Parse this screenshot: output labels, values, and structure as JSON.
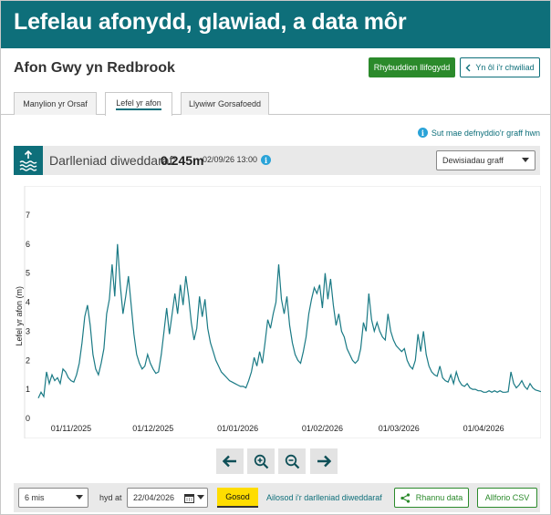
{
  "header": {
    "title": "Lefelau afonydd, glawiad, a data môr"
  },
  "station": {
    "name": "Afon Gwy yn Redbrook"
  },
  "actions": {
    "flood_warnings": "Rhybuddion llifogydd",
    "back_to_search": "Yn ôl i'r chwiliad"
  },
  "tabs": [
    {
      "label": "Manylion yr Orsaf",
      "active": false
    },
    {
      "label": "Lefel yr afon",
      "active": true
    },
    {
      "label": "Llywiwr Gorsafoedd",
      "active": false
    }
  ],
  "help_link": "Sut mae defnyddio'r graff hwn",
  "latest": {
    "label": "Darlleniad diweddaraf:",
    "value": "0.245m",
    "timestamp": "02/09/26 13:00"
  },
  "graph_settings": {
    "label": "Dewisiadau graff"
  },
  "chart_data": {
    "type": "line",
    "ylabel": "Lefel yr afon (m)",
    "ylim": [
      0,
      7.5
    ],
    "yticks": [
      0,
      1,
      2,
      3,
      4,
      5,
      6,
      7
    ],
    "xlim": [
      "2025-10-20",
      "2026-04-22"
    ],
    "xticks": [
      {
        "date": "2025-11-01",
        "label": "01/11/2025"
      },
      {
        "date": "2025-12-01",
        "label": "01/12/2025"
      },
      {
        "date": "2026-01-01",
        "label": "01/01/2026"
      },
      {
        "date": "2026-02-01",
        "label": "01/02/2026"
      },
      {
        "date": "2026-03-01",
        "label": "01/03/2026"
      },
      {
        "date": "2026-04-01",
        "label": "01/04/2026"
      }
    ],
    "line_color": "#1a7a85",
    "series": [
      {
        "values": [
          [
            "2025-10-20",
            0.7
          ],
          [
            "2025-10-21",
            0.9
          ],
          [
            "2025-10-22",
            0.75
          ],
          [
            "2025-10-23",
            1.6
          ],
          [
            "2025-10-24",
            1.2
          ],
          [
            "2025-10-25",
            1.5
          ],
          [
            "2025-10-26",
            1.3
          ],
          [
            "2025-10-27",
            1.4
          ],
          [
            "2025-10-28",
            1.2
          ],
          [
            "2025-10-29",
            1.7
          ],
          [
            "2025-10-30",
            1.6
          ],
          [
            "2025-10-31",
            1.4
          ],
          [
            "2025-11-01",
            1.3
          ],
          [
            "2025-11-02",
            1.25
          ],
          [
            "2025-11-03",
            1.5
          ],
          [
            "2025-11-04",
            1.9
          ],
          [
            "2025-11-05",
            2.6
          ],
          [
            "2025-11-06",
            3.5
          ],
          [
            "2025-11-07",
            3.9
          ],
          [
            "2025-11-08",
            3.2
          ],
          [
            "2025-11-09",
            2.2
          ],
          [
            "2025-11-10",
            1.7
          ],
          [
            "2025-11-11",
            1.5
          ],
          [
            "2025-11-12",
            1.9
          ],
          [
            "2025-11-13",
            2.4
          ],
          [
            "2025-11-14",
            3.6
          ],
          [
            "2025-11-15",
            4.1
          ],
          [
            "2025-11-16",
            5.3
          ],
          [
            "2025-11-17",
            4.2
          ],
          [
            "2025-11-18",
            6.0
          ],
          [
            "2025-11-19",
            4.6
          ],
          [
            "2025-11-20",
            3.6
          ],
          [
            "2025-11-21",
            4.2
          ],
          [
            "2025-11-22",
            4.9
          ],
          [
            "2025-11-23",
            3.9
          ],
          [
            "2025-11-24",
            2.9
          ],
          [
            "2025-11-25",
            2.2
          ],
          [
            "2025-11-26",
            1.9
          ],
          [
            "2025-11-27",
            1.7
          ],
          [
            "2025-11-28",
            1.8
          ],
          [
            "2025-11-29",
            2.2
          ],
          [
            "2025-11-30",
            1.9
          ],
          [
            "2025-12-01",
            1.7
          ],
          [
            "2025-12-02",
            1.55
          ],
          [
            "2025-12-03",
            1.6
          ],
          [
            "2025-12-04",
            2.2
          ],
          [
            "2025-12-05",
            3.0
          ],
          [
            "2025-12-06",
            3.8
          ],
          [
            "2025-12-07",
            2.9
          ],
          [
            "2025-12-08",
            3.6
          ],
          [
            "2025-12-09",
            4.3
          ],
          [
            "2025-12-10",
            3.6
          ],
          [
            "2025-12-11",
            4.6
          ],
          [
            "2025-12-12",
            3.9
          ],
          [
            "2025-12-13",
            4.9
          ],
          [
            "2025-12-14",
            4.2
          ],
          [
            "2025-12-15",
            3.3
          ],
          [
            "2025-12-16",
            2.7
          ],
          [
            "2025-12-17",
            3.1
          ],
          [
            "2025-12-18",
            4.2
          ],
          [
            "2025-12-19",
            3.5
          ],
          [
            "2025-12-20",
            4.1
          ],
          [
            "2025-12-21",
            3.1
          ],
          [
            "2025-12-22",
            2.6
          ],
          [
            "2025-12-23",
            2.3
          ],
          [
            "2025-12-24",
            2.0
          ],
          [
            "2025-12-25",
            1.8
          ],
          [
            "2025-12-26",
            1.6
          ],
          [
            "2025-12-27",
            1.5
          ],
          [
            "2025-12-28",
            1.4
          ],
          [
            "2025-12-29",
            1.3
          ],
          [
            "2025-12-30",
            1.25
          ],
          [
            "2025-12-31",
            1.2
          ],
          [
            "2026-01-01",
            1.15
          ],
          [
            "2026-01-02",
            1.1
          ],
          [
            "2026-01-03",
            1.1
          ],
          [
            "2026-01-04",
            1.05
          ],
          [
            "2026-01-05",
            1.3
          ],
          [
            "2026-01-06",
            1.6
          ],
          [
            "2026-01-07",
            2.1
          ],
          [
            "2026-01-08",
            1.8
          ],
          [
            "2026-01-09",
            2.3
          ],
          [
            "2026-01-10",
            1.9
          ],
          [
            "2026-01-11",
            2.6
          ],
          [
            "2026-01-12",
            3.4
          ],
          [
            "2026-01-13",
            3.1
          ],
          [
            "2026-01-14",
            3.6
          ],
          [
            "2026-01-15",
            4.0
          ],
          [
            "2026-01-16",
            5.3
          ],
          [
            "2026-01-17",
            4.1
          ],
          [
            "2026-01-18",
            3.6
          ],
          [
            "2026-01-19",
            4.2
          ],
          [
            "2026-01-20",
            3.2
          ],
          [
            "2026-01-21",
            2.6
          ],
          [
            "2026-01-22",
            2.2
          ],
          [
            "2026-01-23",
            2.0
          ],
          [
            "2026-01-24",
            1.9
          ],
          [
            "2026-01-25",
            2.3
          ],
          [
            "2026-01-26",
            2.8
          ],
          [
            "2026-01-27",
            3.6
          ],
          [
            "2026-01-28",
            4.1
          ],
          [
            "2026-01-29",
            4.5
          ],
          [
            "2026-01-30",
            4.3
          ],
          [
            "2026-01-31",
            4.6
          ],
          [
            "2026-02-01",
            3.8
          ],
          [
            "2026-02-02",
            5.0
          ],
          [
            "2026-02-03",
            4.1
          ],
          [
            "2026-02-04",
            4.8
          ],
          [
            "2026-02-05",
            3.9
          ],
          [
            "2026-02-06",
            3.2
          ],
          [
            "2026-02-07",
            3.6
          ],
          [
            "2026-02-08",
            3.0
          ],
          [
            "2026-02-09",
            2.8
          ],
          [
            "2026-02-10",
            2.4
          ],
          [
            "2026-02-11",
            2.2
          ],
          [
            "2026-02-12",
            2.0
          ],
          [
            "2026-02-13",
            1.9
          ],
          [
            "2026-02-14",
            2.0
          ],
          [
            "2026-02-15",
            2.4
          ],
          [
            "2026-02-16",
            3.3
          ],
          [
            "2026-02-17",
            3.0
          ],
          [
            "2026-02-18",
            4.3
          ],
          [
            "2026-02-19",
            3.4
          ],
          [
            "2026-02-20",
            3.0
          ],
          [
            "2026-02-21",
            3.3
          ],
          [
            "2026-02-22",
            3.0
          ],
          [
            "2026-02-23",
            2.8
          ],
          [
            "2026-02-24",
            2.7
          ],
          [
            "2026-02-25",
            3.6
          ],
          [
            "2026-02-26",
            3.0
          ],
          [
            "2026-02-27",
            2.7
          ],
          [
            "2026-02-28",
            2.5
          ],
          [
            "2026-03-01",
            2.4
          ],
          [
            "2026-03-02",
            2.3
          ],
          [
            "2026-03-03",
            2.4
          ],
          [
            "2026-03-04",
            2.0
          ],
          [
            "2026-03-05",
            1.8
          ],
          [
            "2026-03-06",
            1.7
          ],
          [
            "2026-03-07",
            2.0
          ],
          [
            "2026-03-08",
            2.9
          ],
          [
            "2026-03-09",
            2.3
          ],
          [
            "2026-03-10",
            3.0
          ],
          [
            "2026-03-11",
            2.2
          ],
          [
            "2026-03-12",
            1.8
          ],
          [
            "2026-03-13",
            1.6
          ],
          [
            "2026-03-14",
            1.5
          ],
          [
            "2026-03-15",
            1.45
          ],
          [
            "2026-03-16",
            1.8
          ],
          [
            "2026-03-17",
            1.4
          ],
          [
            "2026-03-18",
            1.3
          ],
          [
            "2026-03-19",
            1.25
          ],
          [
            "2026-03-20",
            1.5
          ],
          [
            "2026-03-21",
            1.2
          ],
          [
            "2026-03-22",
            1.6
          ],
          [
            "2026-03-23",
            1.3
          ],
          [
            "2026-03-24",
            1.15
          ],
          [
            "2026-03-25",
            1.1
          ],
          [
            "2026-03-26",
            1.2
          ],
          [
            "2026-03-27",
            1.05
          ],
          [
            "2026-03-28",
            1.0
          ],
          [
            "2026-03-29",
            1.0
          ],
          [
            "2026-03-30",
            0.95
          ],
          [
            "2026-03-31",
            0.95
          ],
          [
            "2026-04-01",
            0.9
          ],
          [
            "2026-04-02",
            0.9
          ],
          [
            "2026-04-03",
            0.95
          ],
          [
            "2026-04-04",
            0.9
          ],
          [
            "2026-04-05",
            0.95
          ],
          [
            "2026-04-06",
            0.9
          ],
          [
            "2026-04-07",
            0.95
          ],
          [
            "2026-04-08",
            0.9
          ],
          [
            "2026-04-09",
            0.9
          ],
          [
            "2026-04-10",
            0.92
          ],
          [
            "2026-04-11",
            1.6
          ],
          [
            "2026-04-12",
            1.2
          ],
          [
            "2026-04-13",
            1.05
          ],
          [
            "2026-04-14",
            1.15
          ],
          [
            "2026-04-15",
            1.3
          ],
          [
            "2026-04-16",
            1.1
          ],
          [
            "2026-04-17",
            1.0
          ],
          [
            "2026-04-18",
            1.2
          ],
          [
            "2026-04-19",
            1.05
          ],
          [
            "2026-04-20",
            0.98
          ],
          [
            "2026-04-21",
            0.95
          ],
          [
            "2026-04-22",
            0.92
          ]
        ]
      }
    ]
  },
  "controls": {
    "period": "6 mis",
    "until_label": "hyd at",
    "date": "22/04/2026",
    "set_button": "Gosod",
    "reset_link": "Ailosod i'r darlleniad diweddaraf",
    "share_button": "Rhannu data",
    "export_button": "Allforio CSV"
  }
}
